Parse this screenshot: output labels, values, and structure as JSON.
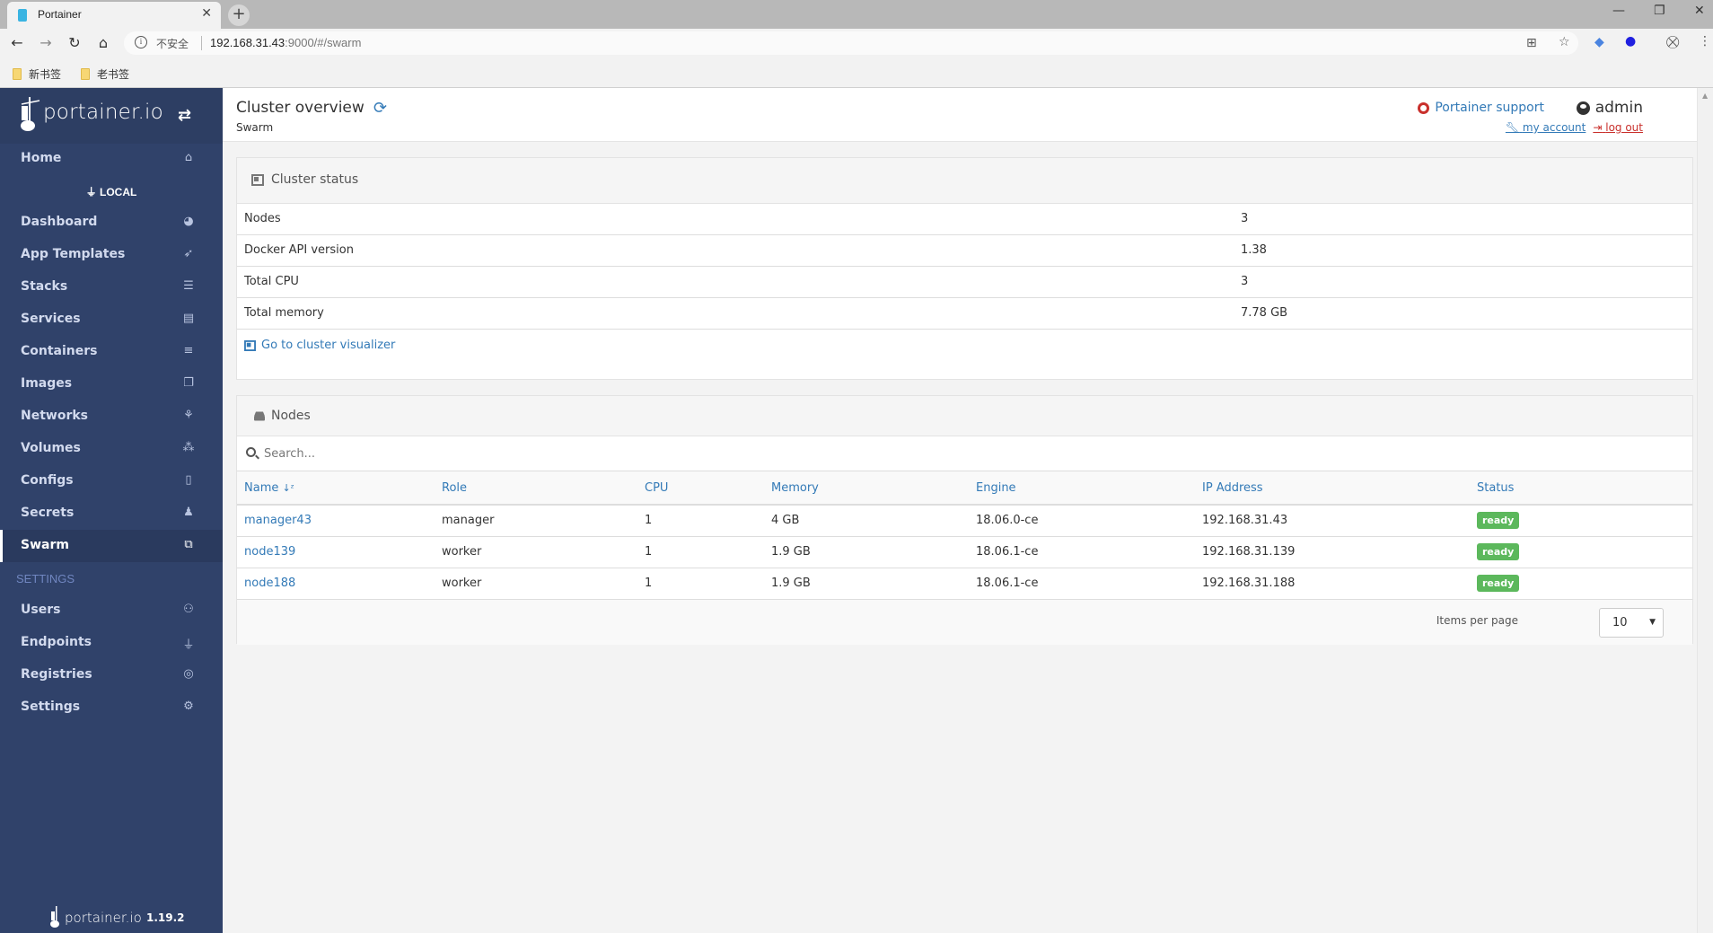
{
  "browser": {
    "tab_title": "Portainer",
    "omnibox_insecure": "不安全",
    "url_host": "192.168.31.43",
    "url_rest": ":9000/#/swarm",
    "bookmarks": [
      "新书签",
      "老书签"
    ]
  },
  "sidebar": {
    "logo_text": "portainer.io",
    "endpoint_label": "LOCAL",
    "items": [
      {
        "label": "Home",
        "icon": "home-icon",
        "glyph": "⌂"
      },
      {
        "label": "Dashboard",
        "icon": "tachometer-icon",
        "glyph": "◕"
      },
      {
        "label": "App Templates",
        "icon": "rocket-icon",
        "glyph": "➶"
      },
      {
        "label": "Stacks",
        "icon": "th-list-icon",
        "glyph": "☰"
      },
      {
        "label": "Services",
        "icon": "list-alt-icon",
        "glyph": "▤"
      },
      {
        "label": "Containers",
        "icon": "server-icon",
        "glyph": "≡"
      },
      {
        "label": "Images",
        "icon": "clone-icon",
        "glyph": "❐"
      },
      {
        "label": "Networks",
        "icon": "sitemap-icon",
        "glyph": "⚘"
      },
      {
        "label": "Volumes",
        "icon": "cubes-icon",
        "glyph": "⁂"
      },
      {
        "label": "Configs",
        "icon": "file-code-icon",
        "glyph": "▯"
      },
      {
        "label": "Secrets",
        "icon": "user-secret-icon",
        "glyph": "♟"
      },
      {
        "label": "Swarm",
        "icon": "object-group-icon",
        "glyph": "⧉",
        "active": true
      }
    ],
    "settings_section": "SETTINGS",
    "settings_items": [
      {
        "label": "Users",
        "icon": "users-icon",
        "glyph": "⚇"
      },
      {
        "label": "Endpoints",
        "icon": "plug-icon",
        "glyph": "⏚"
      },
      {
        "label": "Registries",
        "icon": "database-icon",
        "glyph": "◎"
      },
      {
        "label": "Settings",
        "icon": "cogs-icon",
        "glyph": "⚙"
      }
    ],
    "footer_logo": "portainer.io",
    "version": "1.19.2"
  },
  "header": {
    "title": "Cluster overview",
    "subtitle": "Swarm",
    "support_label": "Portainer support",
    "username": "admin",
    "my_account": "my account",
    "log_out": "log out"
  },
  "cluster_status": {
    "title": "Cluster status",
    "rows": [
      {
        "key": "Nodes",
        "value": "3"
      },
      {
        "key": "Docker API version",
        "value": "1.38"
      },
      {
        "key": "Total CPU",
        "value": "3"
      },
      {
        "key": "Total memory",
        "value": "7.78 GB"
      }
    ],
    "visualizer_link": "Go to cluster visualizer"
  },
  "nodes": {
    "title": "Nodes",
    "search_placeholder": "Search...",
    "columns": [
      "Name",
      "Role",
      "CPU",
      "Memory",
      "Engine",
      "IP Address",
      "Status"
    ],
    "rows": [
      {
        "name": "manager43",
        "role": "manager",
        "cpu": "1",
        "memory": "4 GB",
        "engine": "18.06.0-ce",
        "ip": "192.168.31.43",
        "status": "ready"
      },
      {
        "name": "node139",
        "role": "worker",
        "cpu": "1",
        "memory": "1.9 GB",
        "engine": "18.06.1-ce",
        "ip": "192.168.31.139",
        "status": "ready"
      },
      {
        "name": "node188",
        "role": "worker",
        "cpu": "1",
        "memory": "1.9 GB",
        "engine": "18.06.1-ce",
        "ip": "192.168.31.188",
        "status": "ready"
      }
    ],
    "items_per_page_label": "Items per page",
    "items_per_page_value": "10"
  },
  "colors": {
    "sidebar_bg": "#30426a",
    "accent_link": "#337ab7",
    "status_ready": "#5cb85c",
    "logout_red": "#c9302c"
  }
}
